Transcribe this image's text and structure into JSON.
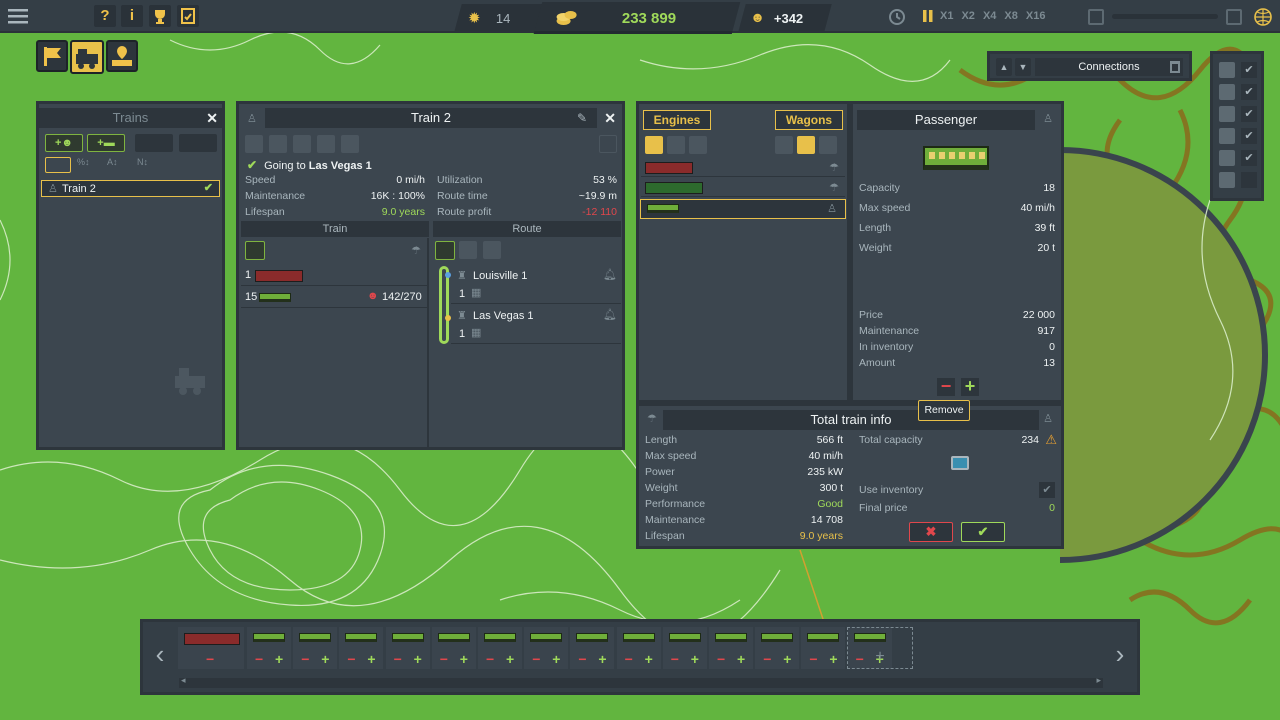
{
  "topbar": {
    "research_count": "14",
    "money": "233 899",
    "happiness": "+342",
    "speed_options": [
      "X1",
      "X2",
      "X4",
      "X8",
      "X16"
    ],
    "left_icons": [
      "menu-icon",
      "help-icon",
      "info-icon",
      "trophy-icon",
      "tasks-icon"
    ]
  },
  "connections": {
    "label": "Connections"
  },
  "trains_panel": {
    "title": "Trains",
    "items": [
      {
        "label": "Train 2"
      }
    ]
  },
  "train_panel": {
    "title": "Train 2",
    "status_prefix": "Going to",
    "status_dest": "Las Vegas 1",
    "stats_left": [
      {
        "k": "Speed",
        "v": "0 mi/h"
      },
      {
        "k": "Maintenance",
        "v": "16K : 100%"
      },
      {
        "k": "Lifespan",
        "v": "9.0 years"
      }
    ],
    "stats_right": [
      {
        "k": "Utilization",
        "v": "53 %"
      },
      {
        "k": "Route time",
        "v": "~19.9 m"
      },
      {
        "k": "Route profit",
        "v": "-12 110"
      }
    ],
    "col_train": "Train",
    "col_route": "Route",
    "consist": [
      {
        "count": "1",
        "load": ""
      },
      {
        "count": "15",
        "load": "142/270"
      }
    ],
    "stops": [
      {
        "name": "Louisville 1",
        "n": "1"
      },
      {
        "name": "Las Vegas 1",
        "n": "1"
      }
    ]
  },
  "shop": {
    "tab_engines": "Engines",
    "tab_wagons": "Wagons"
  },
  "wagon_info": {
    "title": "Passenger",
    "specs": [
      {
        "k": "Capacity",
        "v": "18"
      },
      {
        "k": "Max speed",
        "v": "40 mi/h"
      },
      {
        "k": "Length",
        "v": "39 ft"
      },
      {
        "k": "Weight",
        "v": "20 t"
      }
    ],
    "costs": [
      {
        "k": "Price",
        "v": "22 000"
      },
      {
        "k": "Maintenance",
        "v": "917"
      },
      {
        "k": "In inventory",
        "v": "0"
      },
      {
        "k": "Amount",
        "v": "13"
      }
    ],
    "tooltip": "Remove"
  },
  "total_info": {
    "title": "Total train info",
    "left": [
      {
        "k": "Length",
        "v": "566 ft"
      },
      {
        "k": "Max speed",
        "v": "40 mi/h"
      },
      {
        "k": "Power",
        "v": "235 kW"
      },
      {
        "k": "Weight",
        "v": "300 t"
      },
      {
        "k": "Performance",
        "v": "Good"
      },
      {
        "k": "Maintenance",
        "v": "14 708"
      },
      {
        "k": "Lifespan",
        "v": "9.0 years"
      }
    ],
    "total_capacity_label": "Total capacity",
    "total_capacity": "234",
    "use_inventory": "Use inventory",
    "final_price_label": "Final price",
    "final_price": "0"
  },
  "colors": {
    "accent": "#e8c04a",
    "green": "#9fd95a",
    "red": "#e0474c",
    "panel": "#3c464f"
  }
}
